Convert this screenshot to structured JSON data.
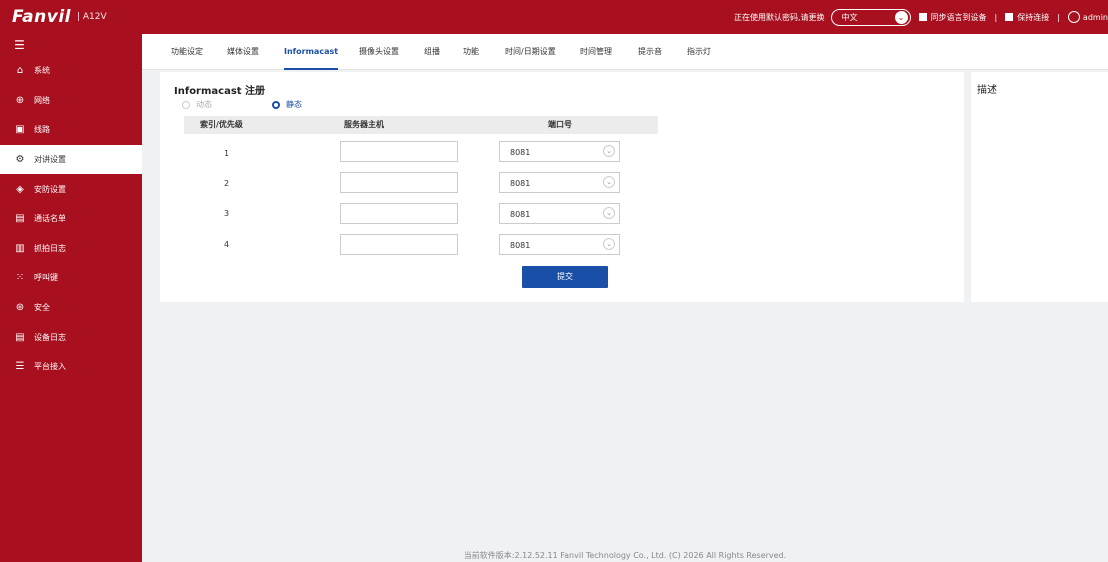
{
  "header": {
    "logo": "Fanvil",
    "model": "| A12V",
    "notice": "正在使用默认密码,请更换",
    "language": "中文",
    "sync_label": "同步语言到设备",
    "keep_label": "保持连接",
    "separator": "|",
    "user": "admin",
    "colors": {
      "brand": "#a8101f",
      "accent": "#1a4fa8"
    }
  },
  "sidebar": {
    "toggle_icon": "menu-icon",
    "items": [
      {
        "label": "系统",
        "icon": "home-icon",
        "active": false
      },
      {
        "label": "网络",
        "icon": "globe-icon",
        "active": false
      },
      {
        "label": "线路",
        "icon": "line-icon",
        "active": false
      },
      {
        "label": "对讲设置",
        "icon": "gear-icon",
        "active": true
      },
      {
        "label": "安防设置",
        "icon": "security-icon",
        "active": false
      },
      {
        "label": "通话名单",
        "icon": "contacts-icon",
        "active": false
      },
      {
        "label": "抓拍日志",
        "icon": "log-icon",
        "active": false
      },
      {
        "label": "呼叫键",
        "icon": "keypad-icon",
        "active": false
      },
      {
        "label": "安全",
        "icon": "shield-icon",
        "active": false
      },
      {
        "label": "设备日志",
        "icon": "doc-icon",
        "active": false
      },
      {
        "label": "平台接入",
        "icon": "sliders-icon",
        "active": false
      }
    ]
  },
  "tabs": [
    {
      "label": "功能设定",
      "active": false
    },
    {
      "label": "媒体设置",
      "active": false
    },
    {
      "label": "Informacast",
      "active": true
    },
    {
      "label": "摄像头设置",
      "active": false
    },
    {
      "label": "组播",
      "active": false
    },
    {
      "label": "功能",
      "active": false
    },
    {
      "label": "时间/日期设置",
      "active": false
    },
    {
      "label": "时间管理",
      "active": false
    },
    {
      "label": "提示音",
      "active": false
    },
    {
      "label": "指示灯",
      "active": false
    }
  ],
  "form": {
    "title": "Informacast 注册",
    "radio_dynamic": "动态",
    "radio_static": "静态",
    "selected_mode": "静态",
    "columns": [
      "索引/优先级",
      "服务器主机",
      "端口号"
    ],
    "rows": [
      {
        "index": "1",
        "host": "",
        "port": "8081"
      },
      {
        "index": "2",
        "host": "",
        "port": "8081"
      },
      {
        "index": "3",
        "host": "",
        "port": "8081"
      },
      {
        "index": "4",
        "host": "",
        "port": "8081"
      }
    ],
    "submit_label": "提交"
  },
  "description": {
    "title": "描述"
  },
  "footer": "当前软件版本:2.12.52.11    Fanvil Technology Co., Ltd. (C) 2026 All Rights Reserved."
}
